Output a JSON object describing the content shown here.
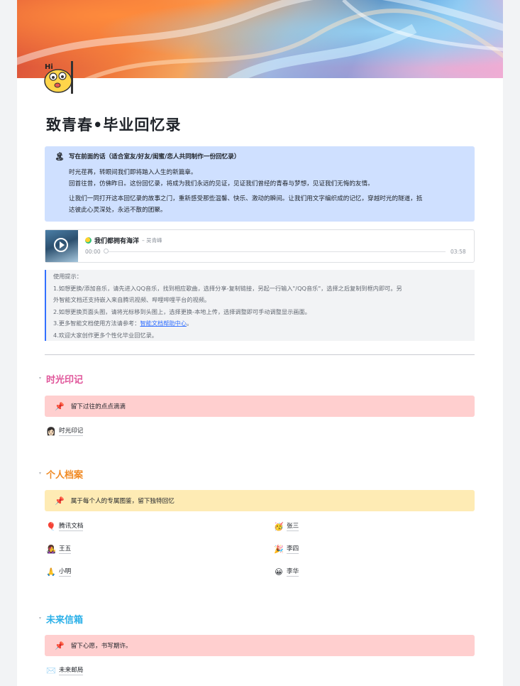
{
  "doc": {
    "title": "致青春•毕业回忆录",
    "colors": {
      "section1": "#e0559a",
      "section2": "#f08a24",
      "section3": "#2bb0e8",
      "callout_blue": "#cfe0ff",
      "band_red": "#ffcfcf",
      "band_yellow": "#feebb4"
    }
  },
  "intro": {
    "heading": "写在前面的话（适合室友/好友/闺蜜/恋人共同制作一份回忆录）",
    "icon": "umbrella-beach-icon",
    "lines": [
      "时光荏苒，转眼间我们即将踏入人生的新篇章。",
      "回首往昔，仿佛昨日。这份回忆录，将成为我们永远的见证，见证我们曾经的青春与梦想，见证我们无悔的友情。",
      "让我们一同打开这本回忆录的故事之门，重新感受那些温馨、快乐、激动的瞬间。让我们用文字编织成的记忆，穿越时光的隧道，抵",
      "达彼此心灵深处，永远不散的团聚。"
    ]
  },
  "music": {
    "song": "我们都拥有海洋",
    "artist": "– 吴青峰",
    "current": "00:00",
    "duration": "03:58",
    "progress": 0
  },
  "tips": {
    "title": "使用提示：",
    "lines": [
      "1.如想更换/添加音乐，请先进入QQ音乐，找到相应歌曲，选择分享-复制链接，另起一行输入\"/QQ音乐\"，选择之后复制到框内即可。另",
      "外智能文档还支持嵌入来自腾讯视频、哔哩哔哩平台的视频。",
      "2.如想更换页面头图，请将光标移到头图上，选择更换-本地上传，选择调整即可手动调整显示画面。"
    ],
    "line3_prefix": "3.更多智能文档使用方法请参考：",
    "line3_link": "智能文档帮助中心",
    "line3_suffix": "。",
    "line4": "4.欢迎大家创作更多个性化毕业回忆录。"
  },
  "sections": [
    {
      "title": "时光印记",
      "band": "留下过往的点点滴滴",
      "items": [
        {
          "emoji": "👩🏻",
          "label": "时光印记"
        }
      ]
    },
    {
      "title": "个人档案",
      "band": "属于每个人的专属图鉴，留下独特回忆",
      "items": [
        {
          "emoji": "🎈",
          "label": "腾讯文档"
        },
        {
          "emoji": "🥳",
          "label": "张三"
        },
        {
          "emoji": "👩‍🎤",
          "label": "王五"
        },
        {
          "emoji": "🎉",
          "label": "李四"
        },
        {
          "emoji": "🙏",
          "label": "小明"
        },
        {
          "emoji": "😀",
          "label": "李华"
        }
      ]
    },
    {
      "title": "未来信箱",
      "band": "留下心愿，书写期许。",
      "items": [
        {
          "emoji": "✉️",
          "label": "未来邮局"
        }
      ]
    }
  ]
}
